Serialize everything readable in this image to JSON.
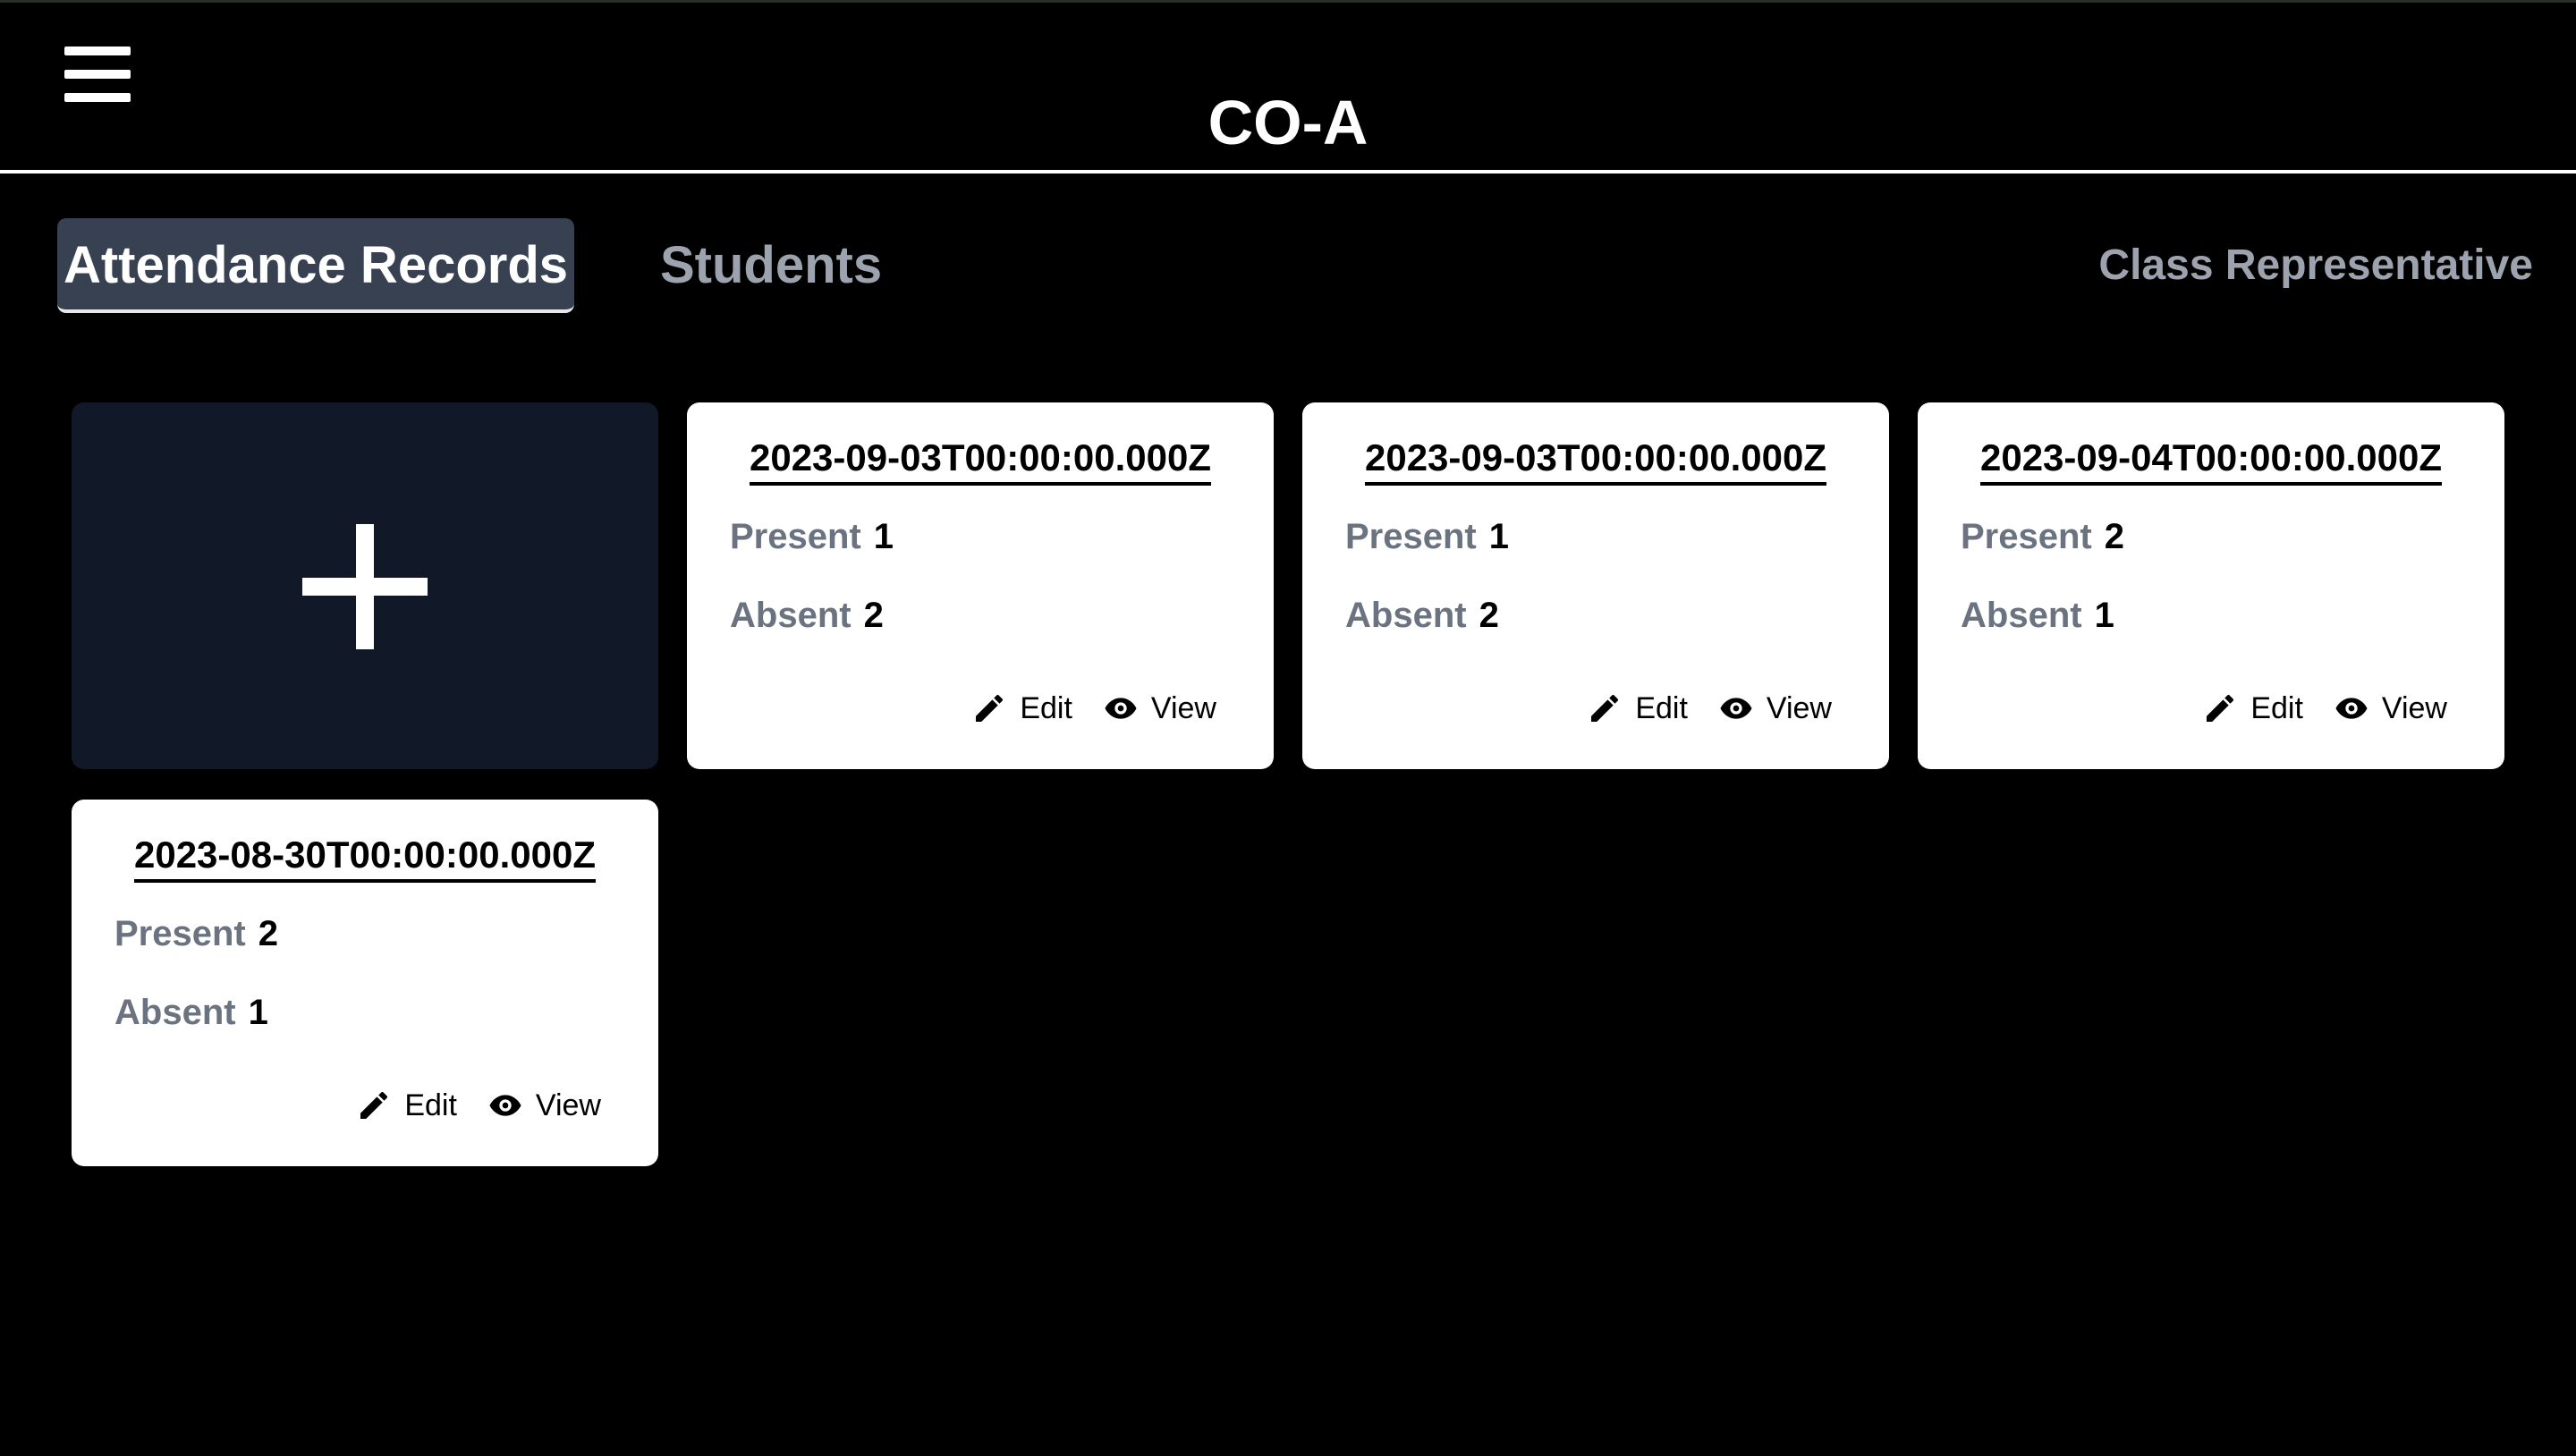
{
  "header": {
    "title": "CO-A",
    "menu_icon": "hamburger-menu-icon"
  },
  "tabs": [
    {
      "label": "Attendance Records",
      "active": true
    },
    {
      "label": "Students",
      "active": false
    }
  ],
  "role": "Class Representative",
  "add_card": {
    "icon": "plus-icon"
  },
  "records": [
    {
      "date": "2023-09-03T00:00:00.000Z",
      "present_label": "Present",
      "present": "1",
      "absent_label": "Absent",
      "absent": "2",
      "edit_label": "Edit",
      "view_label": "View"
    },
    {
      "date": "2023-09-03T00:00:00.000Z",
      "present_label": "Present",
      "present": "1",
      "absent_label": "Absent",
      "absent": "2",
      "edit_label": "Edit",
      "view_label": "View"
    },
    {
      "date": "2023-09-04T00:00:00.000Z",
      "present_label": "Present",
      "present": "2",
      "absent_label": "Absent",
      "absent": "1",
      "edit_label": "Edit",
      "view_label": "View"
    },
    {
      "date": "2023-08-30T00:00:00.000Z",
      "present_label": "Present",
      "present": "2",
      "absent_label": "Absent",
      "absent": "1",
      "edit_label": "Edit",
      "view_label": "View"
    }
  ],
  "colors": {
    "background": "#000000",
    "active_tab": "#374151",
    "add_card": "#111827",
    "muted_text": "#9ca3af",
    "label_text": "#6b7280"
  }
}
